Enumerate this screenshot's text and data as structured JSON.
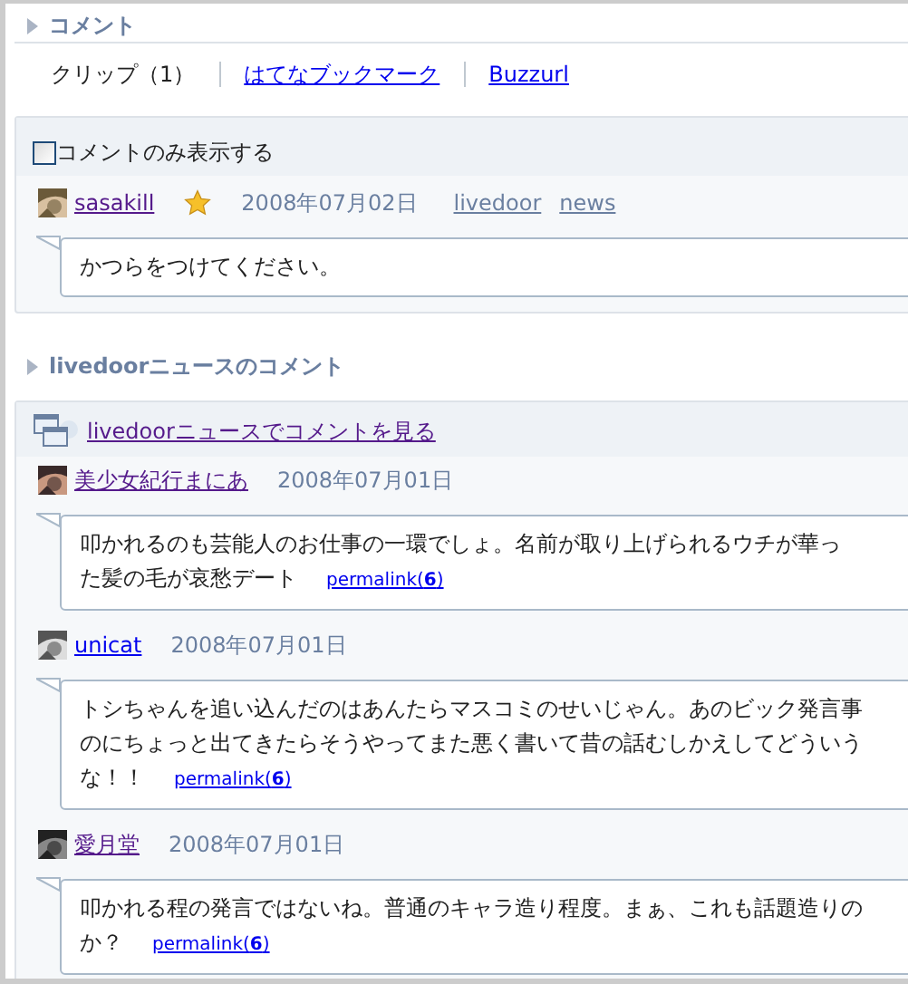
{
  "section": {
    "title": "コメント"
  },
  "tabs": [
    {
      "label": "クリップ（1）",
      "selected": true
    },
    {
      "label": "はてなブックマーク",
      "selected": false
    },
    {
      "label": "Buzzurl",
      "selected": false
    }
  ],
  "clip_panel": {
    "filter": {
      "label": "コメントのみ表示する",
      "checked": false
    },
    "comments": [
      {
        "user": "sasakill",
        "visited": true,
        "starred": true,
        "date": "2008年07月02日",
        "tags": [
          "livedoor",
          "news"
        ],
        "lines": [
          "かつらをつけてください。"
        ]
      }
    ]
  },
  "news_section": {
    "title": "livedoorニュースのコメント",
    "link": "livedoorニュースでコメントを見る",
    "comments": [
      {
        "user": "美少女紀行まにあ",
        "visited": true,
        "date": "2008年07月01日",
        "lines": [
          "叩かれるのも芸能人のお仕事の一環でしょ。名前が取り上げられるウチが華っ",
          "た髪の毛が哀愁デート"
        ],
        "permalink": "permalink(**6**)"
      },
      {
        "user": "unicat",
        "visited": false,
        "date": "2008年07月01日",
        "lines": [
          "トシちゃんを追い込んだのはあんたらマスコミのせいじゃん。あのビック発言事",
          "のにちょっと出てきたらそうやってまた悪く書いて昔の話むしかえしてどういう",
          "な！！"
        ],
        "permalink": "permalink(**6**)"
      },
      {
        "user": "愛月堂",
        "visited": true,
        "date": "2008年07月01日",
        "lines": [
          "叩かれる程の発言ではないね。普通のキャラ造り程度。まぁ、これも話題造りの",
          "か？"
        ],
        "permalink": "permalink(**6**)"
      }
    ]
  }
}
